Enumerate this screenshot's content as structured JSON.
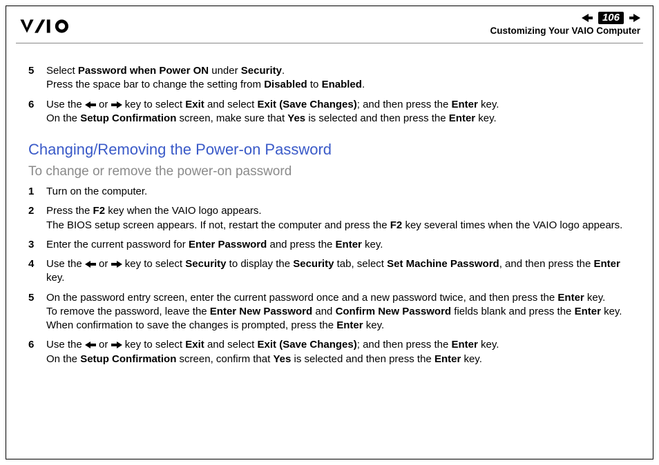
{
  "header": {
    "page_number": "106",
    "section_title": "Customizing Your VAIO Computer"
  },
  "topSteps": [
    {
      "num": "5",
      "html": "Select <b>Password when Power ON</b> under <b>Security</b>.<br>Press the space bar to change the setting from <b>Disabled</b> to <b>Enabled</b>."
    },
    {
      "num": "6",
      "html": "Use the {L} or {R} key to select <b>Exit</b> and select <b>Exit (Save Changes)</b>; and then press the <b>Enter</b> key.<br>On the <b>Setup Confirmation</b> screen, make sure that <b>Yes</b> is selected and then press the <b>Enter</b> key."
    }
  ],
  "heading_blue": "Changing/Removing the Power-on Password",
  "heading_gray": "To change or remove the power-on password",
  "steps": [
    {
      "num": "1",
      "html": "Turn on the computer."
    },
    {
      "num": "2",
      "html": "Press the <b>F2</b> key when the VAIO logo appears.<br>The BIOS setup screen appears. If not, restart the computer and press the <b>F2</b> key several times when the VAIO logo appears."
    },
    {
      "num": "3",
      "html": "Enter the current password for <b>Enter Password</b> and press the <b>Enter</b> key."
    },
    {
      "num": "4",
      "html": "Use the {L} or {R} key to select <b>Security</b> to display the <b>Security</b> tab, select <b>Set Machine Password</b>, and then press the <b>Enter</b> key."
    },
    {
      "num": "5",
      "html": "On the password entry screen, enter the current password once and a new password twice, and then press the <b>Enter</b> key.<br>To remove the password, leave the <b>Enter New Password</b> and <b>Confirm New Password</b> fields blank and press the <b>Enter</b> key.<br>When confirmation to save the changes is prompted, press the <b>Enter</b> key."
    },
    {
      "num": "6",
      "html": "Use the {L} or {R} key to select <b>Exit</b> and select <b>Exit (Save Changes)</b>; and then press the <b>Enter</b> key.<br>On the <b>Setup Confirmation</b> screen, confirm that <b>Yes</b> is selected and then press the <b>Enter</b> key."
    }
  ]
}
